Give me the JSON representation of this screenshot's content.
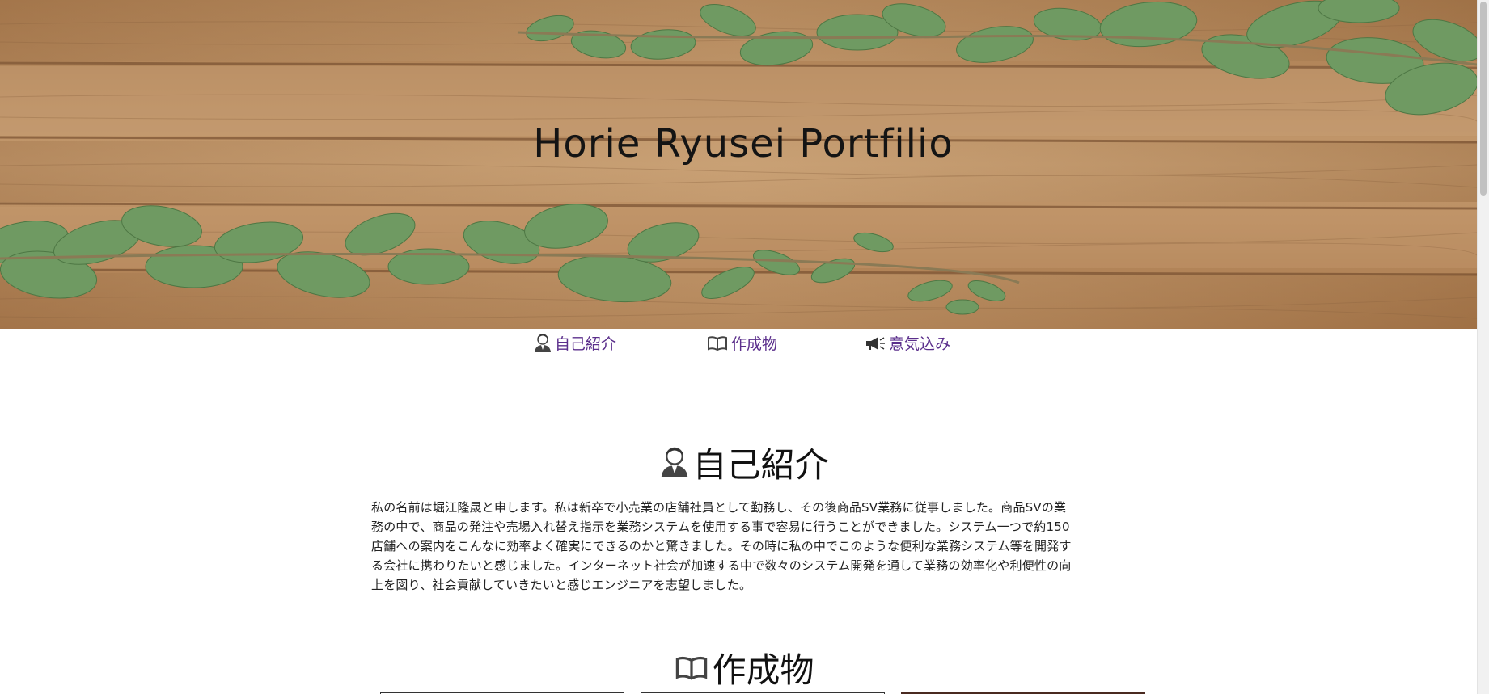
{
  "hero": {
    "title": "Horie Ryusei Portfilio"
  },
  "nav": {
    "items": [
      {
        "label": "自己紹介",
        "icon": "person-icon"
      },
      {
        "label": "作成物",
        "icon": "book-icon"
      },
      {
        "label": "意気込み",
        "icon": "megaphone-icon"
      }
    ]
  },
  "self_intro": {
    "heading": "自己紹介",
    "lines": [
      "私の名前は堀江隆晟と申します。私は新卒で小売業の店舗社員として勤務し、その後商品SV業務に従事しました。商品SVの業",
      "務の中で、商品の発注や売場入れ替え指示を業務システムを使用する事で容易に行うことができました。システム一つで約150",
      "店舗への案内をこんなに効率よく確実にできるのかと驚きました。その時に私の中でこのような便利な業務システム等を開発す",
      "る会社に携わりたいと感じました。インターネット社会が加速する中で数々のシステム開発を通して業務の効率化や利便性の向",
      "上を図り、社会貢献していきたいと感じエンジニアを志望しました。"
    ]
  },
  "works": {
    "heading": "作成物"
  },
  "colors": {
    "nav_link": "#5b2f8c",
    "heading_text": "#111111",
    "body_text": "#222222",
    "hero_wood": "#b88a5c",
    "leaf": "#6f9a62"
  }
}
